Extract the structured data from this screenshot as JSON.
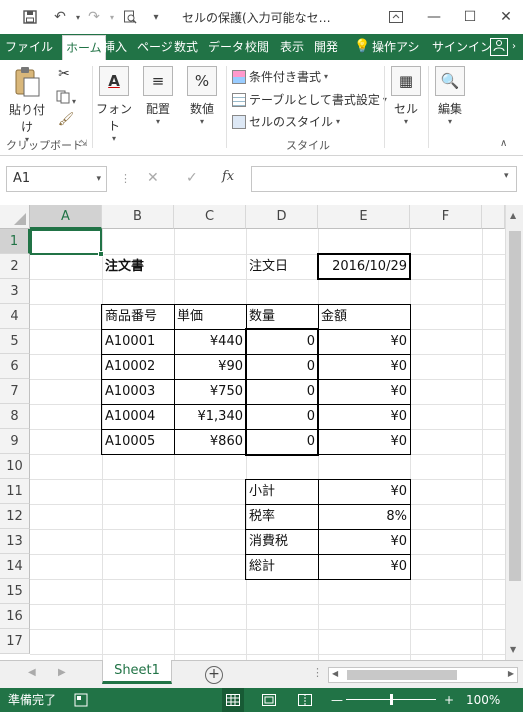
{
  "window": {
    "title": "セルの保護(入力可能なセ…",
    "controls": {
      "minimize": "—",
      "maximize": "☐",
      "close": "✕"
    }
  },
  "quick_access": {
    "save": "save-icon",
    "undo": "undo-icon",
    "redo": "redo-icon",
    "preview": "print-preview-icon"
  },
  "ribbon_tabs": {
    "file": "ファイル",
    "tabs": [
      "ホーム",
      "挿入",
      "ページ",
      "数式",
      "データ",
      "校閲",
      "表示",
      "開発"
    ],
    "tell_me": "操作アシ",
    "signin": "サインイン"
  },
  "ribbon": {
    "paste": "貼り付け",
    "clipboard_group": "クリップボード",
    "font": "フォント",
    "alignment": "配置",
    "number": "数値",
    "conditional_format": "条件付き書式",
    "format_as_table": "テーブルとして書式設定",
    "cell_styles": "セルのスタイル",
    "styles_group": "スタイル",
    "cells": "セル",
    "editing": "編集"
  },
  "formula_bar": {
    "name_box": "A1",
    "fx": "fx",
    "content": ""
  },
  "sheet": {
    "columns": [
      "A",
      "B",
      "C",
      "D",
      "E",
      "F"
    ],
    "rows": [
      "1",
      "2",
      "3",
      "4",
      "5",
      "6",
      "7",
      "8",
      "9",
      "10",
      "11",
      "12",
      "13",
      "14",
      "15",
      "16",
      "17"
    ],
    "order_title": "注文書",
    "order_date_label": "注文日",
    "order_date": "2016/10/29",
    "headers": [
      "商品番号",
      "単価",
      "数量",
      "金額"
    ],
    "items": [
      {
        "code": "A10001",
        "price": "¥440",
        "qty": "0",
        "amount": "¥0"
      },
      {
        "code": "A10002",
        "price": "¥90",
        "qty": "0",
        "amount": "¥0"
      },
      {
        "code": "A10003",
        "price": "¥750",
        "qty": "0",
        "amount": "¥0"
      },
      {
        "code": "A10004",
        "price": "¥1,340",
        "qty": "0",
        "amount": "¥0"
      },
      {
        "code": "A10005",
        "price": "¥860",
        "qty": "0",
        "amount": "¥0"
      }
    ],
    "summary": [
      {
        "label": "小計",
        "value": "¥0"
      },
      {
        "label": "税率",
        "value": "8%"
      },
      {
        "label": "消費税",
        "value": "¥0"
      },
      {
        "label": "総計",
        "value": "¥0"
      }
    ]
  },
  "sheet_tabs": {
    "active": "Sheet1",
    "add": "+"
  },
  "status": {
    "ready": "準備完了",
    "zoom": "100%"
  },
  "colors": {
    "accent": "#217346"
  }
}
